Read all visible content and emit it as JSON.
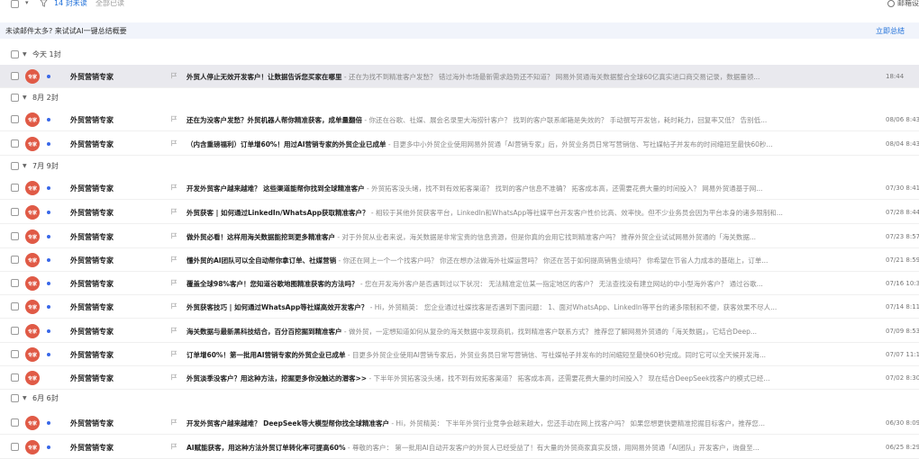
{
  "toolbar": {
    "unread": "14 封未读",
    "mark_all_read": "全部已读",
    "settings": "邮箱设"
  },
  "banner": {
    "text": "未读邮件太多? 来试试AI一键总结概要",
    "link": "立即总结"
  },
  "avatar_label": "专家",
  "colors": {
    "accent": "#1e6fd9",
    "avatar": "#e05a46",
    "unread_dot": "#3867e8"
  },
  "groups": [
    {
      "label": "今天 1封",
      "rows": [
        {
          "sender": "外贸营销专家",
          "subject": "外贸人停止无效开发客户！让数据告诉您买家在哪里",
          "preview": " - 还在为找不到精准客户发愁？ 错过海外市场最新需求趋势还不知道？ 网易外贸通海关数据整合全球60亿真实进口商交易记录，数据量领...",
          "time": "18:44",
          "unread": true,
          "selected": true
        }
      ]
    },
    {
      "label": "8月 2封",
      "rows": [
        {
          "sender": "外贸营销专家",
          "subject": "还在为没客户发愁？外贸机器人帮你精准获客，成单量翻倍",
          "preview": " - 你还在谷歌、社媒、展会名录里大海捞针客户？ 找到的客户联系邮箱是失效的？ 手动撰写开发信，耗时耗力，回复率又低？ 告别低...",
          "time": "08/06 8:43",
          "unread": true,
          "selected": false
        },
        {
          "sender": "外贸营销专家",
          "subject": "（内含重磅福利）订单增60%！用过AI营销专家的外贸企业已成单",
          "preview": " - 目更多中小外贸企业使用网易外贸通「AI营销专家」后，外贸业务员日常写营销信、写社媒帖子并发布的时间缩短至最快60秒...",
          "time": "08/04 8:43",
          "unread": true,
          "selected": false
        }
      ]
    },
    {
      "label": "7月 9封",
      "rows": [
        {
          "sender": "外贸营销专家",
          "subject": "开发外贸客户越来越难？ 这些渠道能帮你找到全球精准客户",
          "preview": " - 外贸拓客没头绪，找不到有效拓客渠道？ 找到的客户信息不准确？ 拓客成本高，还需要花费大量的时间投入？ 网易外贸通基于网...",
          "time": "07/30 8:41",
          "unread": true,
          "selected": false
        },
        {
          "sender": "外贸营销专家",
          "subject": "外贸获客 | 如何通过LinkedIn/WhatsApp获取精准客户？",
          "preview": " - 相较于其他外贸获客平台，LinkedIn和WhatsApp等社媒平台开发客户性价比高、效率快。但不少业务员会因为平台本身的诸多限制和...",
          "time": "07/28 8:44",
          "unread": true,
          "selected": false
        },
        {
          "sender": "外贸营销专家",
          "subject": "做外贸必看！这样用海关数据能挖到更多精准客户",
          "preview": " - 对于外贸从业者来说，海关数据是非常宝贵的信息资源，但是你真的会用它找到精准客户吗？ 推荐外贸企业试试网易外贸通的「海关数据...",
          "time": "07/23 8:57",
          "unread": true,
          "selected": false
        },
        {
          "sender": "外贸营销专家",
          "subject": "懂外贸的AI团队可以全自动帮你拿订单、社媒营销",
          "preview": " - 你还在网上一个一个找客户吗？ 你还在想办法做海外社媒运营吗？ 你还在苦于如何提高销售业绩吗？ 你希望在节省人力成本的基础上，订单...",
          "time": "07/21 8:59",
          "unread": true,
          "selected": false
        },
        {
          "sender": "外贸营销专家",
          "subject": "覆盖全球98%客户！您知道谷歌地图精准获客的方法吗？",
          "preview": " - 您在开发海外客户是否遇到过以下状况： 无法精准定位某一指定地区的客户？ 无法查找没有建立网站的中小型海外客户？ 通过谷歌...",
          "time": "07/16 10:39",
          "unread": true,
          "selected": false
        },
        {
          "sender": "外贸营销专家",
          "subject": "外贸获客技巧 | 如何通过WhatsApp等社媒高效开发客户？",
          "preview": " - Hi，外贸精英： 您企业通过社媒找客是否遇到下面问题： 1、面对WhatsApp、LinkedIn等平台的诸多限制和不便，获客效果不尽人...",
          "time": "07/14 8:11",
          "unread": true,
          "selected": false
        },
        {
          "sender": "外贸营销专家",
          "subject": "海关数据与最新黑科技结合，百分百挖掘到精准客户",
          "preview": " - 做外贸，一定想知道如何从复杂的海关数据中发现商机，找到精准客户联系方式？ 推荐您了解网易外贸通的「海关数据」，它结合Deep...",
          "time": "07/09 8:53",
          "unread": true,
          "selected": false
        },
        {
          "sender": "外贸营销专家",
          "subject": "订单增60%！第一批用AI营销专家的外贸企业已成单",
          "preview": " - 目更多外贸企业使用AI营销专家后，外贸业务员日常写营销信、写社媒帖子并发布的时间缩短至最快60秒完成。同时它可以全天候开发海...",
          "time": "07/07 11:10",
          "unread": true,
          "selected": false
        },
        {
          "sender": "外贸营销专家",
          "subject": "外贸淡季没客户？用这种方法，挖掘更多你没触达的潜客>>",
          "preview": " - 下半年外贸拓客没头绪，找不到有效拓客渠道？ 拓客成本高，还需要花费大量的时间投入？ 现在结合DeepSeek找客户的模式已经...",
          "time": "07/02 8:30",
          "unread": false,
          "selected": false
        }
      ]
    },
    {
      "label": "6月 6封",
      "rows": [
        {
          "sender": "外贸营销专家",
          "subject": "开发外贸客户越来越难？ DeepSeek等大模型帮你找全球精准客户",
          "preview": " - Hi，外贸精英： 下半年外贸行业竞争会越来越大，您还手动在网上找客户吗？ 如果您想更快更精准挖掘目标客户，推荐您...",
          "time": "06/30 8:09",
          "unread": true,
          "selected": false
        },
        {
          "sender": "外贸营销专家",
          "subject": "AI赋能获客，用这种方法外贸订单转化率可提高60%",
          "preview": " - 尊敬的客户： 第一批用AI自动开发客户的外贸人已经受益了！有大量的外贸商家真实反馈，用网易外贸通「AI团队」开发客户，询盘至...",
          "time": "06/25 8:29",
          "unread": true,
          "selected": false
        }
      ]
    }
  ]
}
